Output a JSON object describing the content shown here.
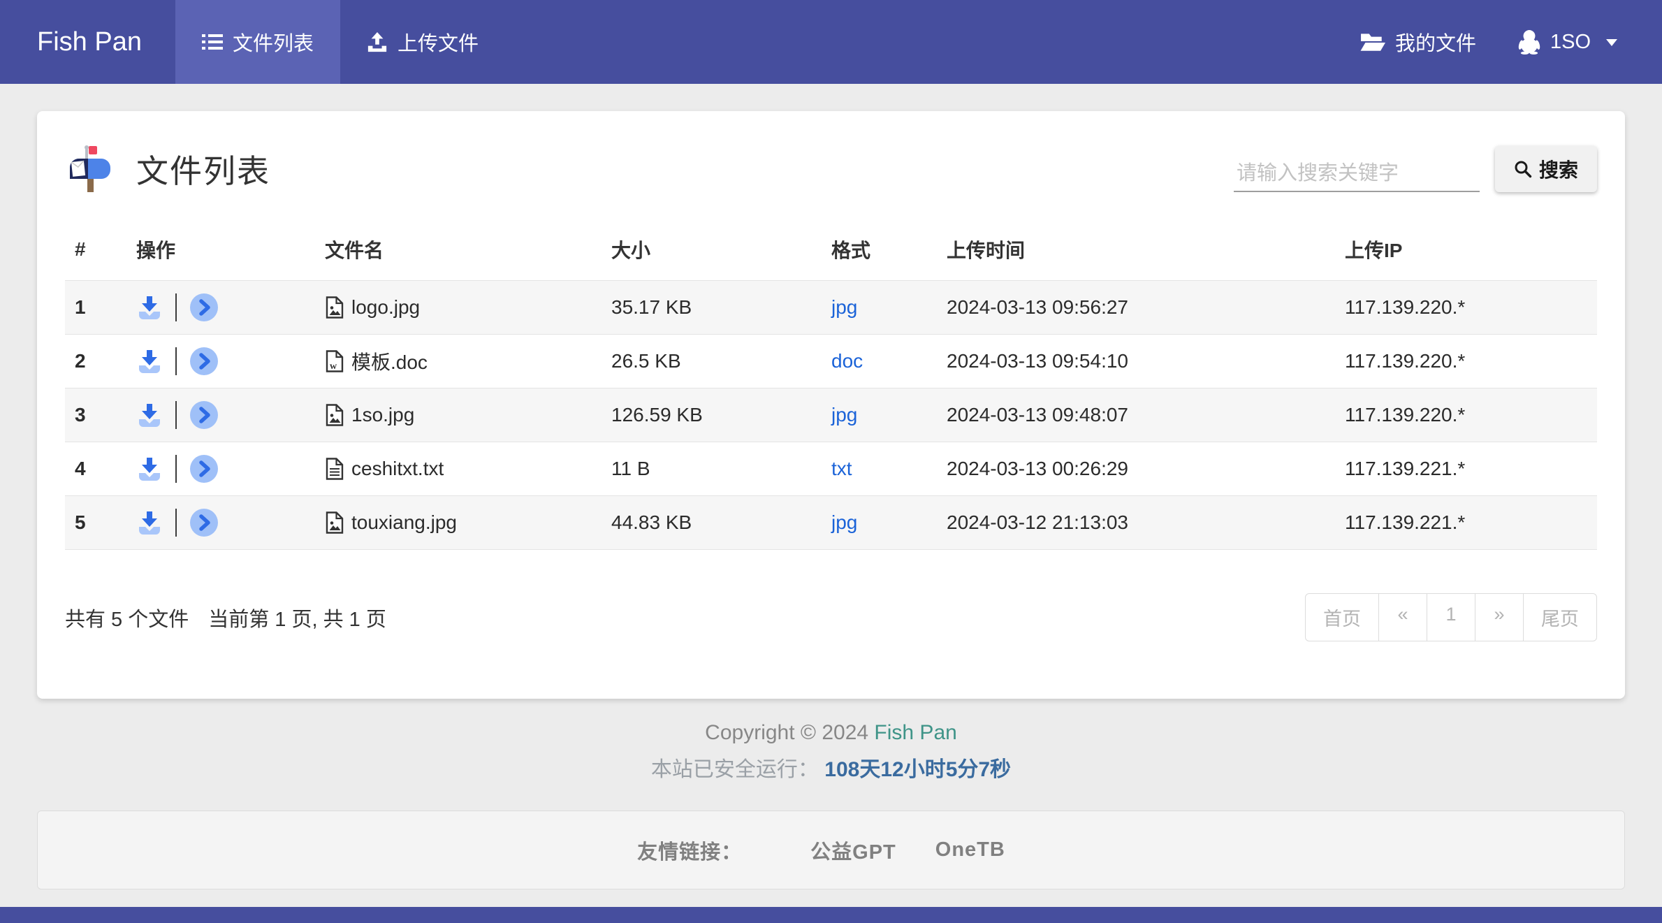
{
  "nav": {
    "brand": "Fish Pan",
    "tabs": [
      {
        "label": "文件列表",
        "icon": "list-icon"
      },
      {
        "label": "上传文件",
        "icon": "upload-icon"
      }
    ],
    "my_files_label": "我的文件",
    "user": {
      "name": "1SO",
      "icon": "qq-penguin-icon"
    }
  },
  "page": {
    "title": "文件列表",
    "title_icon": "mailbox-icon",
    "search": {
      "placeholder": "请输入搜索关键字",
      "button_label": "搜索",
      "icon": "search-icon"
    }
  },
  "table": {
    "headers": [
      "#",
      "操作",
      "文件名",
      "大小",
      "格式",
      "上传时间",
      "上传IP"
    ],
    "action_icons": {
      "download": "download-icon",
      "open": "chevron-right-circle-icon"
    },
    "rows": [
      {
        "index": "1",
        "file_icon": "file-image-icon",
        "name": "logo.jpg",
        "size": "35.17 KB",
        "format": "jpg",
        "time": "2024-03-13 09:56:27",
        "ip": "117.139.220.*"
      },
      {
        "index": "2",
        "file_icon": "file-word-icon",
        "name": "模板.doc",
        "size": "26.5 KB",
        "format": "doc",
        "time": "2024-03-13 09:54:10",
        "ip": "117.139.220.*"
      },
      {
        "index": "3",
        "file_icon": "file-image-icon",
        "name": "1so.jpg",
        "size": "126.59 KB",
        "format": "jpg",
        "time": "2024-03-13 09:48:07",
        "ip": "117.139.220.*"
      },
      {
        "index": "4",
        "file_icon": "file-text-icon",
        "name": "ceshitxt.txt",
        "size": "11 B",
        "format": "txt",
        "time": "2024-03-13 00:26:29",
        "ip": "117.139.221.*"
      },
      {
        "index": "5",
        "file_icon": "file-image-icon",
        "name": "touxiang.jpg",
        "size": "44.83 KB",
        "format": "jpg",
        "time": "2024-03-12 21:13:03",
        "ip": "117.139.221.*"
      }
    ]
  },
  "summary": {
    "total": "共有 5 个文件",
    "page_info": "当前第 1 页, 共 1 页"
  },
  "pagination": {
    "items": [
      "首页",
      "«",
      "1",
      "»",
      "尾页"
    ]
  },
  "footer": {
    "copyright_prefix": "Copyright © 2024 ",
    "brand": "Fish Pan",
    "uptime_label": "本站已安全运行：",
    "uptime_value": "108天12小时5分7秒",
    "links_label": "友情链接：",
    "links": [
      "公益GPT",
      "OneTB"
    ]
  },
  "colors": {
    "navbar": "#464e9e",
    "navbar_active_tab": "#5b63b4",
    "accent_blue": "#2e6be5",
    "light_blue": "#9fc0f8",
    "link_blue": "#1b63d8",
    "brand_teal": "#3f9488",
    "uptime_blue": "#3a6b9f",
    "page_background": "#ececec"
  }
}
